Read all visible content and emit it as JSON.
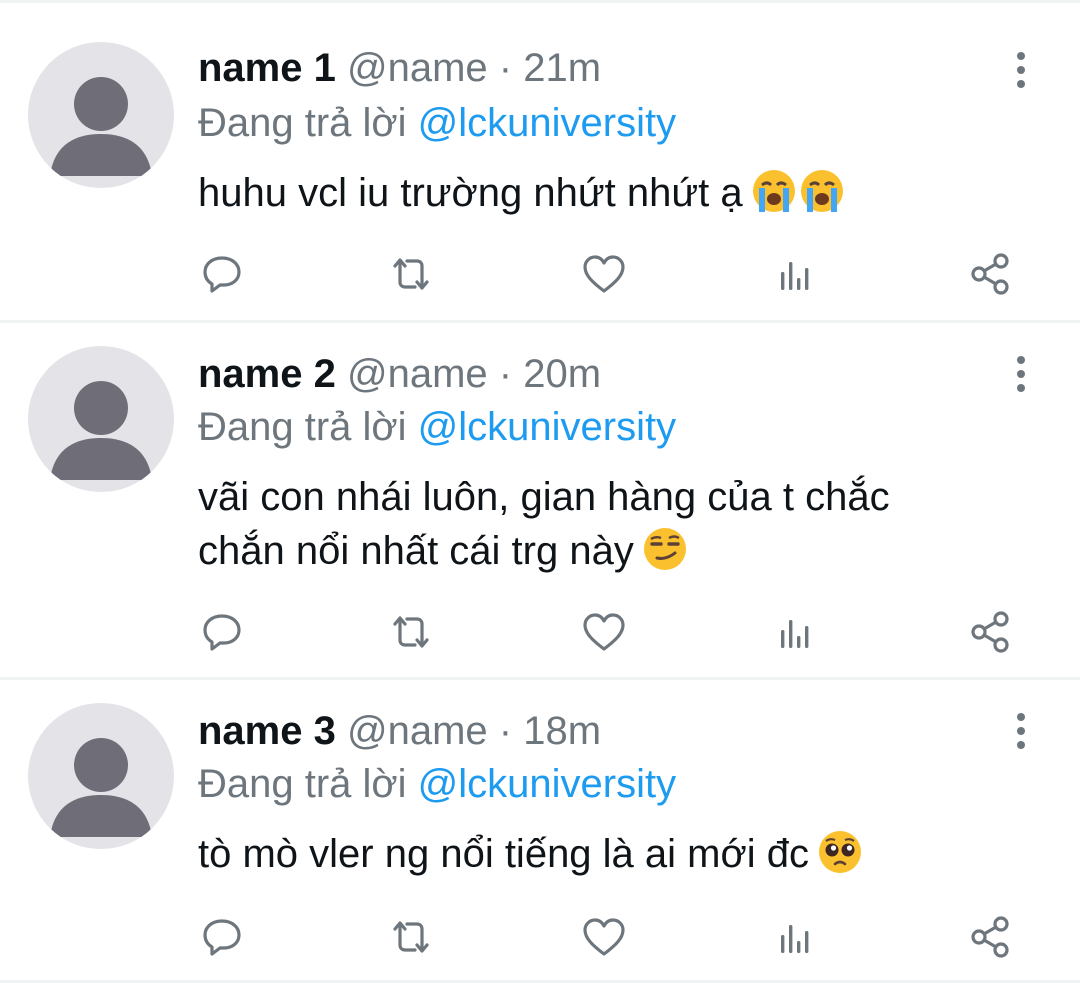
{
  "tweets": [
    {
      "name": "name 1",
      "handle": "@name",
      "separator": "·",
      "time": "21m",
      "reply_prefix": "Đang trả lời",
      "reply_mention": "@lckuniversity",
      "text_lines": [
        "huhu vcl iu trường nhứt nhứt ạ"
      ],
      "emojis": [
        "loudly-crying-face",
        "loudly-crying-face"
      ]
    },
    {
      "name": "name 2",
      "handle": "@name",
      "separator": "·",
      "time": "20m",
      "reply_prefix": "Đang trả lời",
      "reply_mention": "@lckuniversity",
      "text_lines": [
        "vãi con nhái luôn, gian hàng của t chắc",
        "chắn nổi nhất cái trg này"
      ],
      "emojis": [
        "smirking-face"
      ]
    },
    {
      "name": "name 3",
      "handle": "@name",
      "separator": "·",
      "time": "18m",
      "reply_prefix": "Đang trả lời",
      "reply_mention": "@lckuniversity",
      "text_lines": [
        "tò mò vler ng nổi tiếng là ai mới đc"
      ],
      "emojis": [
        "pleading-face"
      ]
    }
  ],
  "actions": [
    "reply-icon",
    "retweet-icon",
    "like-icon",
    "analytics-icon",
    "share-icon"
  ],
  "colors": {
    "primary_text": "#0f1419",
    "secondary_text": "#6e767d",
    "mention": "#1d9bf0",
    "avatar_bg": "#e4e3e8",
    "avatar_fg": "#6e6d78",
    "divider": "#eff3f4"
  }
}
